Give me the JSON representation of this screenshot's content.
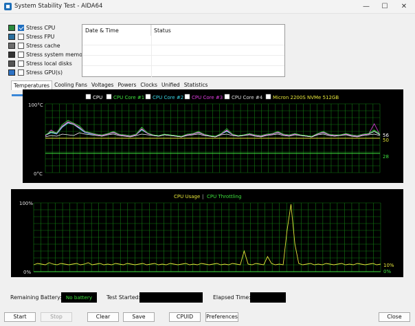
{
  "window": {
    "title": "System Stability Test - AIDA64"
  },
  "stress": [
    {
      "label": "Stress CPU",
      "checked": true,
      "icon": "cpu-chip-icon"
    },
    {
      "label": "Stress FPU",
      "checked": false,
      "icon": "fpu-chip-icon"
    },
    {
      "label": "Stress cache",
      "checked": false,
      "icon": "cache-chip-icon"
    },
    {
      "label": "Stress system memory",
      "checked": false,
      "icon": "memory-module-icon"
    },
    {
      "label": "Stress local disks",
      "checked": false,
      "icon": "disk-drive-icon"
    },
    {
      "label": "Stress GPU(s)",
      "checked": false,
      "icon": "monitor-icon"
    }
  ],
  "log": {
    "columns": [
      "Date & Time",
      "Status"
    ],
    "rows": []
  },
  "tabs": [
    "Temperatures",
    "Cooling Fans",
    "Voltages",
    "Powers",
    "Clocks",
    "Unified",
    "Statistics"
  ],
  "active_tab": "Temperatures",
  "colors": {
    "grid": "#137a13",
    "cpu": "#ffffff",
    "core1": "#3ee23e",
    "core2": "#3ad7e6",
    "core3": "#e23ee2",
    "core4": "#dcdcdc",
    "ssd": "#e6e63a",
    "usage": "#e6e63a",
    "throttle": "#3ee23e"
  },
  "chart_data": [
    {
      "type": "line",
      "title": "",
      "ylim": [
        0,
        100
      ],
      "y_top_label": "100°C",
      "y_bottom_label": "0°C",
      "legend": [
        "CPU",
        "CPU Core #1",
        "CPU Core #2",
        "CPU Core #3",
        "CPU Core #4",
        "Micron 2200S NVMe 512GB"
      ],
      "series": [
        {
          "name": "CPU",
          "values": [
            52,
            54,
            53,
            56,
            55,
            54,
            58,
            56,
            55,
            54,
            53,
            55,
            56,
            54,
            53,
            52,
            54,
            56,
            55,
            54,
            53,
            55,
            54,
            53,
            52,
            54,
            55,
            56,
            54,
            53,
            52,
            55,
            56,
            54,
            53,
            54,
            55,
            53,
            52,
            54,
            55,
            56,
            54,
            53,
            55,
            54,
            53,
            52,
            55,
            56,
            54,
            53,
            54,
            55,
            53,
            52,
            54,
            55,
            56,
            54
          ],
          "end_label": "56"
        },
        {
          "name": "CPU Core #1",
          "values": [
            55,
            60,
            58,
            70,
            76,
            72,
            68,
            60,
            58,
            56,
            55,
            57,
            60,
            56,
            55,
            54,
            56,
            66,
            58,
            55,
            54,
            56,
            55,
            54,
            53,
            56,
            57,
            60,
            56,
            54,
            53,
            57,
            64,
            56,
            54,
            55,
            57,
            55,
            54,
            56,
            57,
            60,
            56,
            55,
            57,
            55,
            54,
            53,
            57,
            60,
            56,
            55,
            55,
            57,
            55,
            54,
            56,
            57,
            62,
            56
          ]
        },
        {
          "name": "CPU Core #2",
          "values": [
            54,
            58,
            56,
            66,
            72,
            70,
            64,
            58,
            56,
            55,
            54,
            56,
            58,
            55,
            54,
            53,
            55,
            62,
            57,
            54,
            53,
            55,
            54,
            53,
            52,
            55,
            56,
            58,
            55,
            53,
            52,
            56,
            60,
            55,
            53,
            54,
            56,
            54,
            53,
            55,
            56,
            58,
            55,
            54,
            56,
            54,
            53,
            52,
            56,
            58,
            55,
            54,
            54,
            56,
            54,
            53,
            55,
            56,
            60,
            55
          ]
        },
        {
          "name": "CPU Core #3",
          "values": [
            53,
            62,
            57,
            68,
            74,
            71,
            66,
            59,
            57,
            55,
            54,
            56,
            59,
            55,
            54,
            53,
            55,
            64,
            57,
            54,
            53,
            55,
            54,
            53,
            52,
            55,
            56,
            59,
            55,
            53,
            52,
            56,
            62,
            55,
            53,
            54,
            56,
            54,
            53,
            55,
            56,
            59,
            55,
            54,
            56,
            54,
            53,
            52,
            56,
            59,
            55,
            54,
            54,
            56,
            54,
            53,
            55,
            56,
            71,
            55
          ]
        },
        {
          "name": "CPU Core #4",
          "values": [
            54,
            59,
            57,
            67,
            73,
            70,
            65,
            59,
            57,
            55,
            54,
            56,
            58,
            55,
            54,
            53,
            55,
            63,
            57,
            54,
            53,
            55,
            54,
            53,
            52,
            55,
            56,
            58,
            55,
            53,
            52,
            56,
            61,
            55,
            53,
            54,
            56,
            54,
            53,
            55,
            56,
            58,
            55,
            54,
            56,
            54,
            53,
            52,
            56,
            58,
            55,
            54,
            54,
            56,
            54,
            53,
            55,
            56,
            60,
            55
          ]
        },
        {
          "name": "Micron 2200S NVMe 512GB",
          "values": [
            50,
            50,
            50,
            50,
            50,
            50,
            50,
            50,
            50,
            50,
            50,
            50,
            50,
            50,
            50,
            50,
            50,
            50,
            50,
            50,
            50,
            50,
            50,
            50,
            50,
            50,
            50,
            50,
            50,
            50,
            50,
            50,
            50,
            50,
            50,
            50,
            50,
            50,
            50,
            50,
            50,
            50,
            50,
            50,
            50,
            50,
            50,
            50,
            50,
            50,
            50,
            50,
            50,
            50,
            50,
            50,
            50,
            50,
            50,
            50
          ],
          "end_label": "50"
        },
        {
          "name": "",
          "values": [
            28,
            28,
            28,
            28,
            28,
            28,
            28,
            28,
            28,
            28,
            28,
            28,
            28,
            28,
            28,
            28,
            28,
            28,
            28,
            28,
            28,
            28,
            28,
            28,
            28,
            28,
            28,
            28,
            28,
            28,
            28,
            28,
            28,
            28,
            28,
            28,
            28,
            28,
            28,
            28,
            28,
            28,
            28,
            28,
            28,
            28,
            28,
            28,
            28,
            28,
            28,
            28,
            28,
            28,
            28,
            28,
            28,
            28,
            28,
            28
          ],
          "end_label": "28"
        }
      ]
    },
    {
      "type": "line",
      "title": "",
      "ylim": [
        0,
        100
      ],
      "y_top_label": "100%",
      "y_bottom_label": "0%",
      "legend": [
        "CPU Usage",
        "CPU Throttling"
      ],
      "legend_sep": "|",
      "series": [
        {
          "name": "CPU Usage",
          "values": [
            10,
            12,
            11,
            10,
            13,
            11,
            10,
            12,
            11,
            10,
            11,
            12,
            10,
            11,
            13,
            10,
            11,
            12,
            10,
            11,
            10,
            12,
            11,
            10,
            12,
            11,
            10,
            11,
            12,
            10,
            11,
            12,
            10,
            11,
            10,
            12,
            11,
            10,
            11,
            12,
            10,
            11,
            10,
            12,
            11,
            10,
            11,
            12,
            10,
            11,
            10,
            12,
            11,
            10,
            30,
            11,
            10,
            12,
            11,
            10,
            22,
            12,
            10,
            11,
            10,
            60,
            98,
            40,
            12,
            10,
            11,
            12,
            10,
            11,
            10,
            12,
            11,
            10,
            11,
            12,
            10,
            11,
            10,
            12,
            11,
            10,
            11,
            12,
            10,
            11
          ],
          "end_label": "10%"
        },
        {
          "name": "CPU Throttling",
          "values": [
            0,
            0,
            0,
            0,
            0,
            0,
            0,
            0,
            0,
            0,
            0,
            0,
            0,
            0,
            0,
            0,
            0,
            0,
            0,
            0,
            0,
            0,
            0,
            0,
            0,
            0,
            0,
            0,
            0,
            0,
            0,
            0,
            0,
            0,
            0,
            0,
            0,
            0,
            0,
            0,
            0,
            0,
            0,
            0,
            0,
            0,
            0,
            0,
            0,
            0,
            0,
            0,
            0,
            0,
            0,
            0,
            0,
            0,
            0,
            0,
            0,
            0,
            0,
            0,
            0,
            0,
            0,
            0,
            0,
            0,
            0,
            0,
            0,
            0,
            0,
            0,
            0,
            0,
            0,
            0,
            0,
            0,
            0,
            0,
            0,
            0,
            0,
            0,
            0,
            0
          ],
          "end_label": "0%"
        }
      ]
    }
  ],
  "status": {
    "battery_label": "Remaining Battery:",
    "battery_value": "No battery",
    "started_label": "Test Started:",
    "elapsed_label": "Elapsed Time:"
  },
  "buttons": {
    "start": "Start",
    "stop": "Stop",
    "clear": "Clear",
    "save": "Save",
    "cpuid": "CPUID",
    "preferences": "Preferences",
    "close": "Close"
  }
}
